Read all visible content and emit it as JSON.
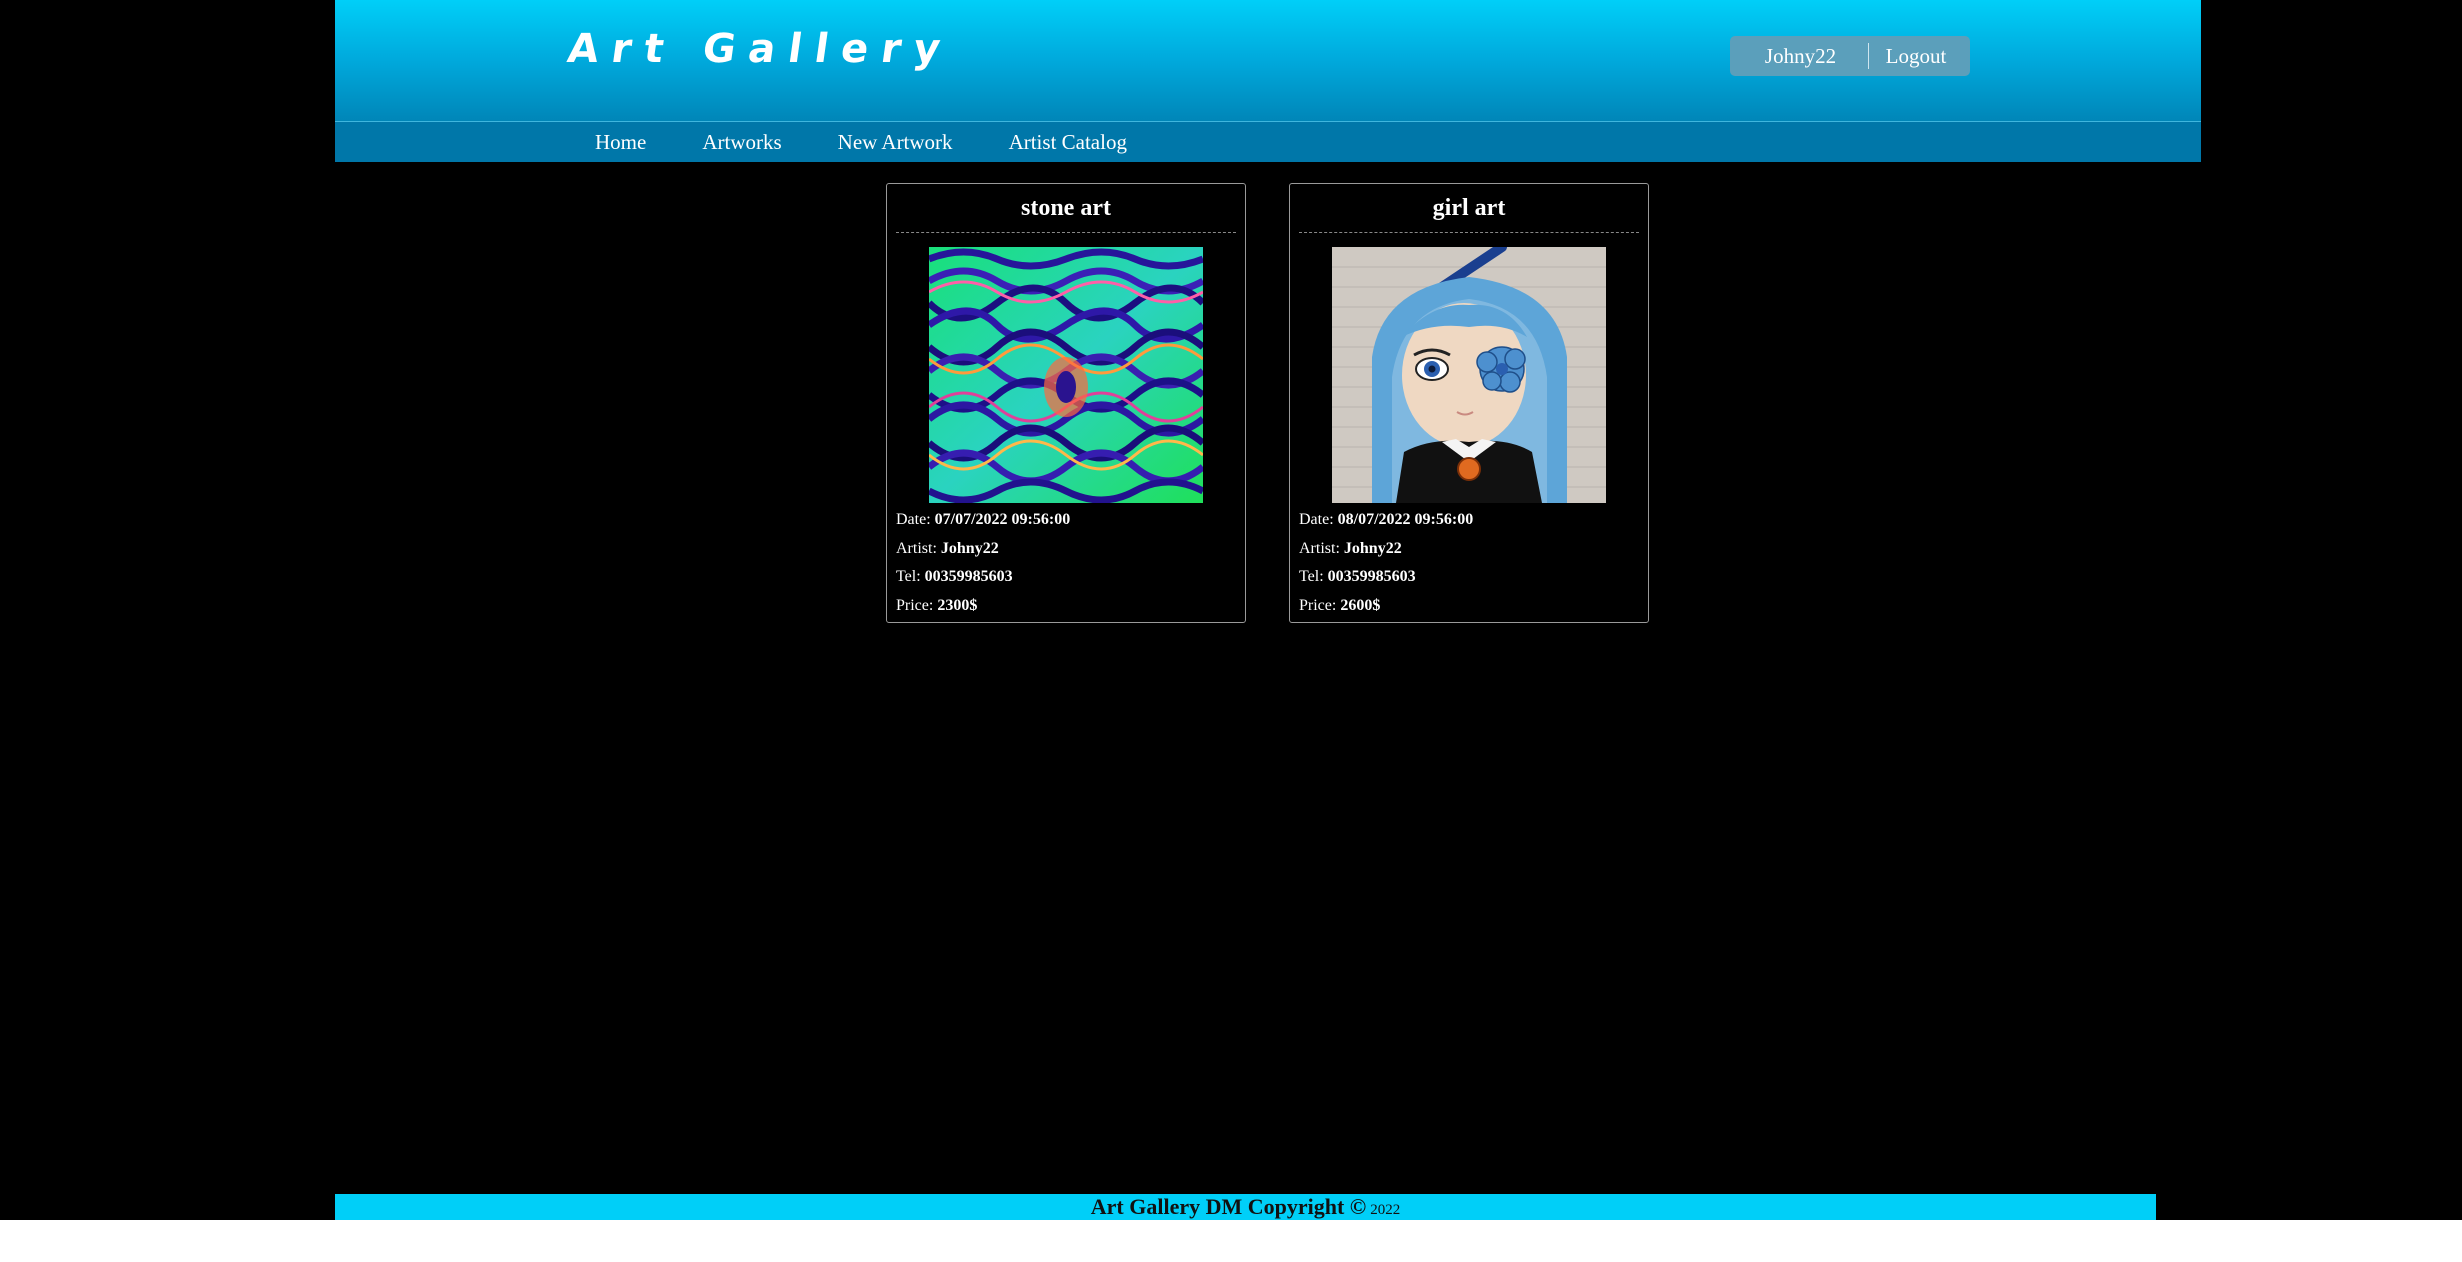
{
  "header": {
    "logo": "Art Gallery",
    "user_name": "Johny22",
    "logout_label": "Logout"
  },
  "nav": {
    "items": [
      {
        "label": "Home"
      },
      {
        "label": "Artworks"
      },
      {
        "label": "New Artwork"
      },
      {
        "label": "Artist Catalog"
      }
    ]
  },
  "artworks": [
    {
      "title": "stone art",
      "date_label": "Date:",
      "date": "07/07/2022 09:56:00",
      "artist_label": "Artist:",
      "artist": "Johny22",
      "tel_label": "Tel:",
      "tel": "00359985603",
      "price_label": "Price:",
      "price": "2300$"
    },
    {
      "title": "girl art",
      "date_label": "Date:",
      "date": "08/07/2022 09:56:00",
      "artist_label": "Artist:",
      "artist": "Johny22",
      "tel_label": "Tel:",
      "tel": "00359985603",
      "price_label": "Price:",
      "price": "2600$"
    }
  ],
  "footer": {
    "text": "Art Gallery DM Copyright ©",
    "year": "2022"
  },
  "colors": {
    "header_top": "#00cff8",
    "header_bottom": "#0086b8",
    "nav_bg": "#0077a9",
    "footer_bg": "#00cff8",
    "page_bg": "#000000"
  }
}
